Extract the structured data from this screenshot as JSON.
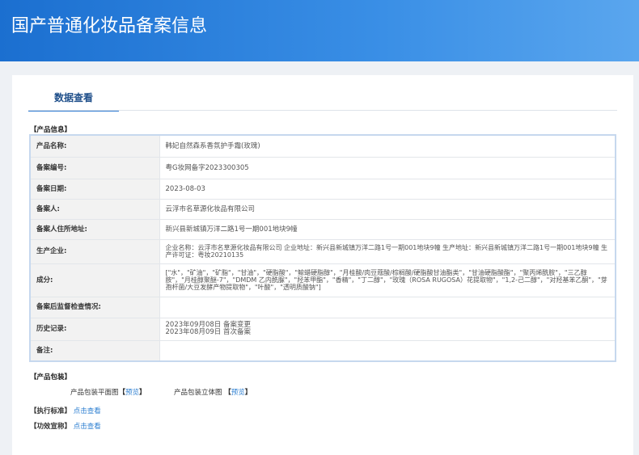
{
  "header": {
    "title": "国产普通化妆品备案信息"
  },
  "tab": {
    "label": "数据查看"
  },
  "product_info": {
    "heading": "【产品信息】",
    "rows": [
      {
        "label": "产品名称:",
        "value": "韩妃自然森系香氛护手霜(玫瑰)"
      },
      {
        "label": "备案编号:",
        "value": "粤G妆网备字2023300305"
      },
      {
        "label": "备案日期:",
        "value": "2023-08-03"
      },
      {
        "label": "备案人:",
        "value": "云浮市名草源化妆品有限公司"
      },
      {
        "label": "备案人住所地址:",
        "value": "新兴县新城镇万洋二路1号一期001地块9幢"
      },
      {
        "label": "生产企业:",
        "value": "企业名称：云浮市名草源化妆品有限公司 企业地址：新兴县新城镇万洋二路1号一期001地块9幢 生产地址：新兴县新城镇万洋二路1号一期001地块9幢 生产许可证：粤妆20210135"
      },
      {
        "label": "成分:",
        "value": "[\"水\"，\"矿油\"，\"矿脂\"，\"甘油\"，\"硬脂酸\"，\"鲸蜡硬脂醇\"，\"月桂酸/肉豆蔻酸/棕榈酸/硬脂酸甘油酯类\"，\"甘油硬脂酸酯\"，\"聚丙烯酰胺\"，\"三乙醇胺\"，\"月桂醇聚醚-7\"，\"DMDM 乙内酰脲\"，\"羟苯甲酯\"，\"香精\"，\"丁二醇\"，\"玫瑰（ROSA RUGOSA）花提取物\"，\"1,2-己二醇\"，\"对羟基苯乙酮\"，\"芽孢杆菌/大豆发酵产物提取物\"，\"叶酸\"，\"透明质酸钠\"]"
      },
      {
        "label": "备案后监督检查情况:",
        "value": ""
      },
      {
        "label": "历史记录:",
        "value": "",
        "lines": [
          "2023年09月08日 备案变更",
          "2023年08月09日 首次备案"
        ]
      },
      {
        "label": "备注:",
        "value": ""
      }
    ]
  },
  "packaging": {
    "heading": "【产品包装】",
    "flat_label": "产品包装平面图",
    "solid_label": "产品包装立体图",
    "bracket_open": "【",
    "bracket_close": "】",
    "preview": "预览"
  },
  "standard": {
    "heading": "【执行标准】",
    "link": "点击查看"
  },
  "efficacy": {
    "heading": "【功效宣称】",
    "link": "点击查看"
  }
}
